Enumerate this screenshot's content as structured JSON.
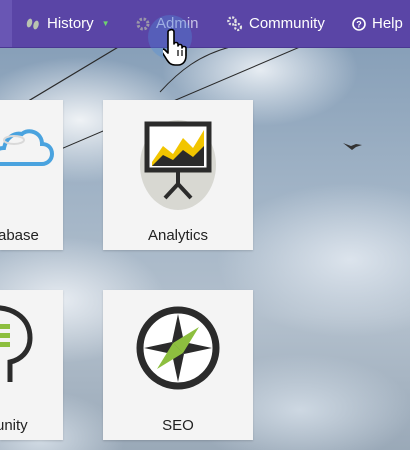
{
  "nav": {
    "history": {
      "label": "History"
    },
    "admin": {
      "label": "Admin"
    },
    "community": {
      "label": "Community"
    },
    "help": {
      "label": "Help"
    }
  },
  "tiles": {
    "database": {
      "label": "abase"
    },
    "analytics": {
      "label": "Analytics"
    },
    "community": {
      "label": "unity"
    },
    "seo": {
      "label": "SEO"
    }
  },
  "colors": {
    "nav_bg": "#5a45a6",
    "accent_green": "#8dbf3f",
    "accent_yellow": "#f2c500",
    "icon_dark": "#2b2b2b",
    "icon_blue": "#4aa3df"
  }
}
